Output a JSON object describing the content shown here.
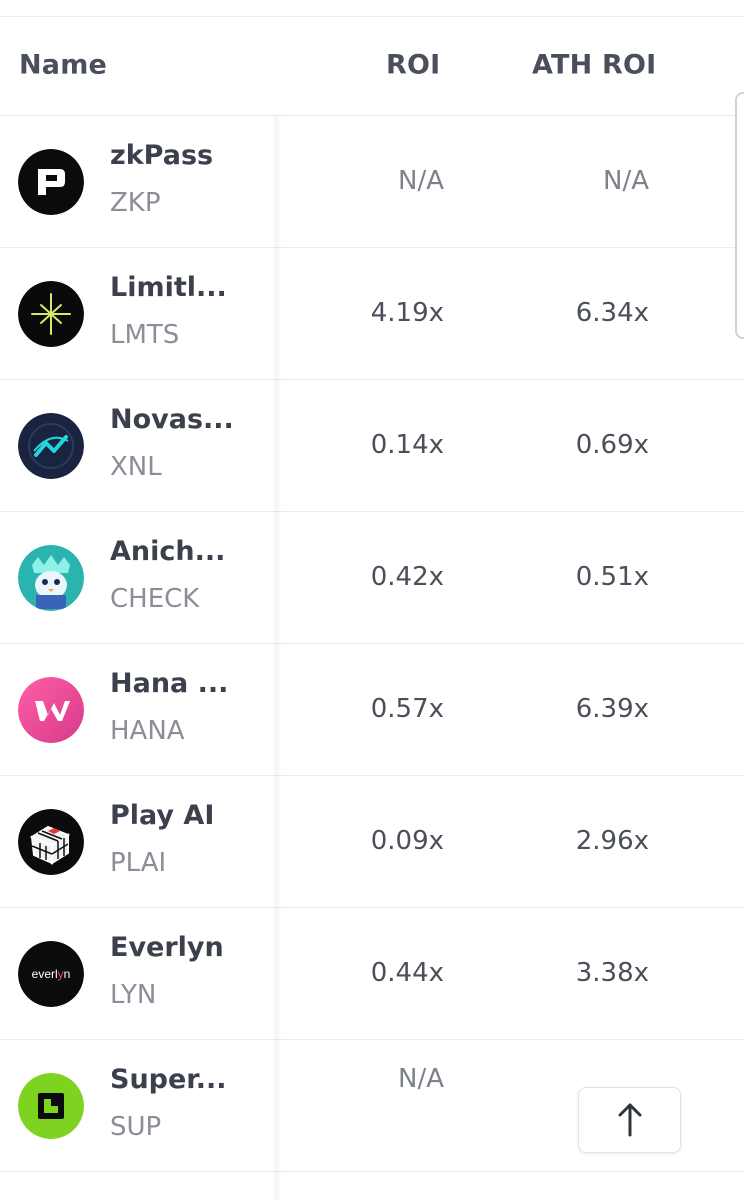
{
  "header": {
    "name": "Name",
    "roi": "ROI",
    "ath_roi": "ATH ROI"
  },
  "rows": [
    {
      "name": "zkPass",
      "symbol": "ZKP",
      "roi": "N/A",
      "ath_roi": "N/A",
      "icon": "zkpass-logo-icon"
    },
    {
      "name": "Limitl...",
      "symbol": "LMTS",
      "roi": "4.19x",
      "ath_roi": "6.34x",
      "icon": "limitless-logo-icon"
    },
    {
      "name": "Novas...",
      "symbol": "XNL",
      "roi": "0.14x",
      "ath_roi": "0.69x",
      "icon": "novastro-logo-icon"
    },
    {
      "name": "Anich...",
      "symbol": "CHECK",
      "roi": "0.42x",
      "ath_roi": "0.51x",
      "icon": "anichess-logo-icon"
    },
    {
      "name": "Hana ...",
      "symbol": "HANA",
      "roi": "0.57x",
      "ath_roi": "6.39x",
      "icon": "hana-logo-icon"
    },
    {
      "name": "Play AI",
      "symbol": "PLAI",
      "roi": "0.09x",
      "ath_roi": "2.96x",
      "icon": "playai-logo-icon"
    },
    {
      "name": "Everlyn",
      "symbol": "LYN",
      "roi": "0.44x",
      "ath_roi": "3.38x",
      "icon": "everlyn-logo-icon",
      "logo_text": "everlyn"
    },
    {
      "name": "Super...",
      "symbol": "SUP",
      "roi": "N/A",
      "ath_roi": "",
      "icon": "super-logo-icon"
    }
  ],
  "colors": {
    "text": "#3b404c",
    "muted": "#8a8e98",
    "divider": "#ececf0",
    "lime": "#7ed321",
    "pink": "#e84aa0"
  },
  "scroll_to_top_icon": "arrow-up-icon"
}
